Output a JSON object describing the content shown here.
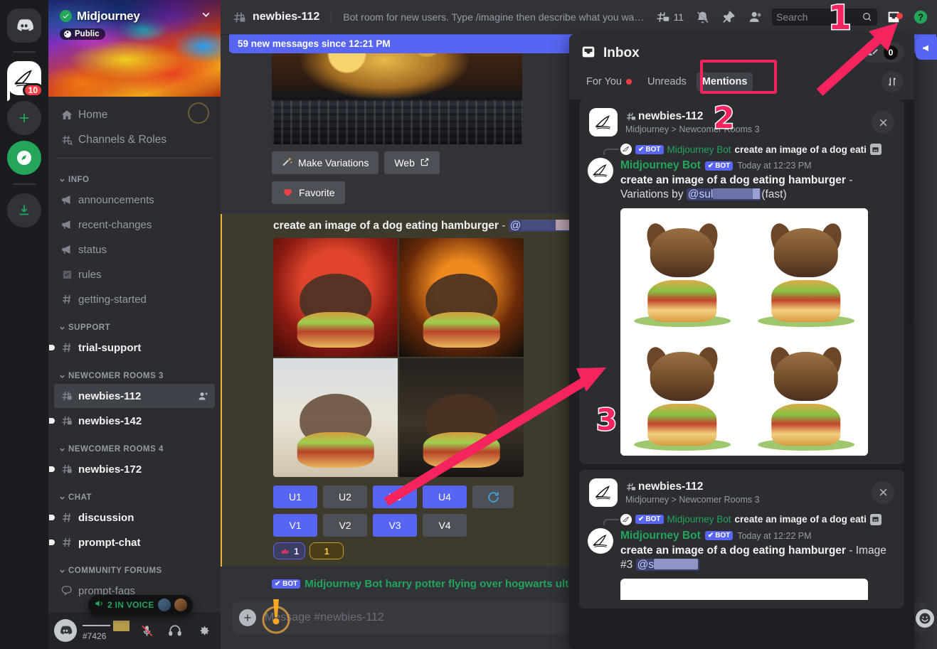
{
  "server_rail": {
    "items": [
      {
        "name": "discord-home",
        "label": "Home",
        "icon": "discord-logo"
      },
      {
        "name": "server-midjourney",
        "label": "Midjourney",
        "icon": "midjourney-sail",
        "badge": "10"
      },
      {
        "name": "add-server",
        "label": "Add a Server",
        "icon": "plus"
      },
      {
        "name": "explore-servers",
        "label": "Explore Discoverable Servers",
        "icon": "compass"
      },
      {
        "name": "download-apps",
        "label": "Download Apps",
        "icon": "download"
      }
    ]
  },
  "sidebar": {
    "guild": {
      "name": "Midjourney",
      "verified": true,
      "public_label": "Public"
    },
    "top_items": [
      {
        "label": "Home",
        "icon": "home-icon"
      },
      {
        "label": "Channels & Roles",
        "icon": "channels-roles-icon"
      }
    ],
    "categories": [
      {
        "label": "INFO",
        "channels": [
          {
            "label": "announcements",
            "icon": "announcement-icon",
            "state": "read"
          },
          {
            "label": "recent-changes",
            "icon": "announcement-icon",
            "state": "read"
          },
          {
            "label": "status",
            "icon": "announcement-icon",
            "state": "read"
          },
          {
            "label": "rules",
            "icon": "rules-icon",
            "state": "read"
          },
          {
            "label": "getting-started",
            "icon": "hash-icon",
            "state": "read"
          }
        ]
      },
      {
        "label": "SUPPORT",
        "channels": [
          {
            "label": "trial-support",
            "icon": "hash-icon",
            "state": "unread"
          }
        ]
      },
      {
        "label": "NEWCOMER ROOMS 3",
        "channels": [
          {
            "label": "newbies-112",
            "icon": "hash-thread-locked-icon",
            "state": "active",
            "trailing": "add-member-icon"
          },
          {
            "label": "newbies-142",
            "icon": "hash-thread-locked-icon",
            "state": "unread"
          }
        ]
      },
      {
        "label": "NEWCOMER ROOMS 4",
        "channels": [
          {
            "label": "newbies-172",
            "icon": "hash-thread-locked-icon",
            "state": "unread"
          }
        ]
      },
      {
        "label": "CHAT",
        "channels": [
          {
            "label": "discussion",
            "icon": "hash-icon",
            "state": "unread"
          },
          {
            "label": "prompt-chat",
            "icon": "hash-icon",
            "state": "unread"
          }
        ]
      },
      {
        "label": "COMMUNITY FORUMS",
        "channels": [
          {
            "label": "prompt-faqs",
            "icon": "forum-icon",
            "state": "read"
          }
        ]
      }
    ],
    "voice_toast": {
      "label": "2 IN VOICE",
      "icon": "speaker-icon"
    },
    "user_bar": {
      "tag": "#7426",
      "buttons": [
        {
          "name": "mute-button",
          "icon": "mic-muted-icon"
        },
        {
          "name": "deafen-button",
          "icon": "headphones-icon"
        },
        {
          "name": "user-settings-button",
          "icon": "gear-icon"
        }
      ]
    }
  },
  "topbar": {
    "channel_name": "newbies-112",
    "topic": "Bot room for new users. Type /imagine then describe what you want ...",
    "threads_count": "11",
    "search_placeholder": "Search",
    "icons": [
      {
        "name": "threads-icon",
        "label": "Threads"
      },
      {
        "name": "notification-off-icon",
        "label": "Notification Settings"
      },
      {
        "name": "pin-icon",
        "label": "Pinned Messages"
      },
      {
        "name": "members-icon",
        "label": "Member List"
      },
      {
        "name": "search-icon",
        "label": "Search"
      },
      {
        "name": "inbox-icon",
        "label": "Inbox"
      },
      {
        "name": "help-icon",
        "label": "Help"
      }
    ]
  },
  "chat": {
    "new_messages_banner": "59 new messages since 12:21 PM",
    "action_buttons": [
      {
        "label": "Make Variations",
        "icon": "sparkle-wand-icon",
        "name": "make-variations-button"
      },
      {
        "label": "Web",
        "icon": "external-link-icon",
        "name": "web-button"
      },
      {
        "label": "Favorite",
        "icon": "heart-icon",
        "name": "favorite-button"
      }
    ],
    "mention_message": {
      "text": "create an image of a dog eating hamburger",
      "separator": "-",
      "mention": "@"
    },
    "upscale_buttons_row1": [
      {
        "label": "U1",
        "style": "primary"
      },
      {
        "label": "U2",
        "style": "secondary"
      },
      {
        "label": "U3",
        "style": "primary"
      },
      {
        "label": "U4",
        "style": "primary"
      },
      {
        "label": "",
        "style": "icon",
        "icon": "refresh-icon"
      }
    ],
    "variation_buttons_row2": [
      {
        "label": "V1",
        "style": "primary"
      },
      {
        "label": "V2",
        "style": "secondary"
      },
      {
        "label": "V3",
        "style": "primary"
      },
      {
        "label": "V4",
        "style": "secondary"
      }
    ],
    "reactions": [
      {
        "emoji": "crown-icon",
        "count": "1",
        "style": "selected"
      },
      {
        "emoji": "",
        "count": "1",
        "style": "gold"
      }
    ],
    "next_message_preview": "Midjourney Bot  harry potter flying over hogwarts ultraso...",
    "composer_placeholder": "Message #newbies-112"
  },
  "inbox": {
    "title": "Inbox",
    "title_icon": "inbox-icon",
    "mark_read_count": "0",
    "mark_read_icon": "mark-read-icon",
    "sort_icon": "sort-icon",
    "tabs": [
      {
        "label": "For You",
        "active": false,
        "has_dot": true
      },
      {
        "label": "Unreads",
        "active": false,
        "has_dot": false
      },
      {
        "label": "Mentions",
        "active": true,
        "has_dot": false
      }
    ],
    "cards": [
      {
        "channel": "newbies-112",
        "breadcrumb": "Midjourney > Newcomer Rooms 3",
        "reference": {
          "bot_tag": "BOT",
          "author": "Midjourney Bot",
          "text": "create an image of a dog eati",
          "attachment_icon": "image-icon"
        },
        "message": {
          "author": "Midjourney Bot",
          "bot_tag": "BOT",
          "timestamp": "Today at 12:23 PM",
          "body_bold": "create an image of a dog eating hamburger",
          "body_rest": "- Variations by",
          "mention": "@sul",
          "suffix": "(fast)"
        }
      },
      {
        "channel": "newbies-112",
        "breadcrumb": "Midjourney > Newcomer Rooms 3",
        "reference": {
          "bot_tag": "BOT",
          "author": "Midjourney Bot",
          "text": "create an image of a dog eati",
          "attachment_icon": "image-icon"
        },
        "message": {
          "author": "Midjourney Bot",
          "bot_tag": "BOT",
          "timestamp": "Today at 12:22 PM",
          "body_bold": "create an image of a dog eating hamburger",
          "body_rest": "- Image #3",
          "mention": "@s",
          "suffix": ""
        }
      }
    ]
  },
  "annotations": {
    "markers": [
      {
        "number": "1",
        "name": "annotation-marker-1"
      },
      {
        "number": "2",
        "name": "annotation-marker-2"
      },
      {
        "number": "3",
        "name": "annotation-marker-3"
      }
    ],
    "highlight_target": "Mentions",
    "accent_color": "#f5245f"
  }
}
